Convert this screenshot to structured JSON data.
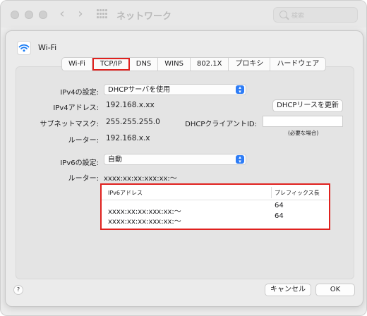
{
  "window": {
    "title": "ネットワーク",
    "search_placeholder": "検索"
  },
  "sheet": {
    "interface_name": "Wi-Fi",
    "tabs": [
      {
        "label": "Wi-Fi"
      },
      {
        "label": "TCP/IP",
        "active": true
      },
      {
        "label": "DNS"
      },
      {
        "label": "WINS"
      },
      {
        "label": "802.1X"
      },
      {
        "label": "プロキシ"
      },
      {
        "label": "ハードウェア"
      }
    ],
    "ipv4": {
      "config_label": "IPv4の設定:",
      "config_value": "DHCPサーバを使用",
      "address_label": "IPv4アドレス:",
      "address_value": "192.168.x.xx",
      "renew_button": "DHCPリースを更新",
      "subnet_label": "サブネットマスク:",
      "subnet_value": "255.255.255.0",
      "client_id_label": "DHCPクライアントID:",
      "client_id_value": "",
      "client_id_hint": "(必要な場合)",
      "router_label": "ルーター:",
      "router_value": "192.168.x.x"
    },
    "ipv6": {
      "config_label": "IPv6の設定:",
      "config_value": "自動",
      "router_label": "ルーター:",
      "router_value": "xxxx:xx:xx:xxx:xx:～",
      "table": {
        "col_address": "IPv6アドレス",
        "col_prefix": "プレフィックス長",
        "rows": [
          {
            "address": "xxxx:xx:xx:xxx:xx:～",
            "prefix": "64"
          },
          {
            "address": "xxxx:xx:xx:xxx:xx:～",
            "prefix": "64"
          }
        ]
      }
    },
    "footer": {
      "help": "?",
      "cancel": "キャンセル",
      "ok": "OK"
    }
  },
  "colors": {
    "highlight": "#e0211e",
    "accent": "#2d7cf6",
    "wifi": "#1a7cf5"
  }
}
